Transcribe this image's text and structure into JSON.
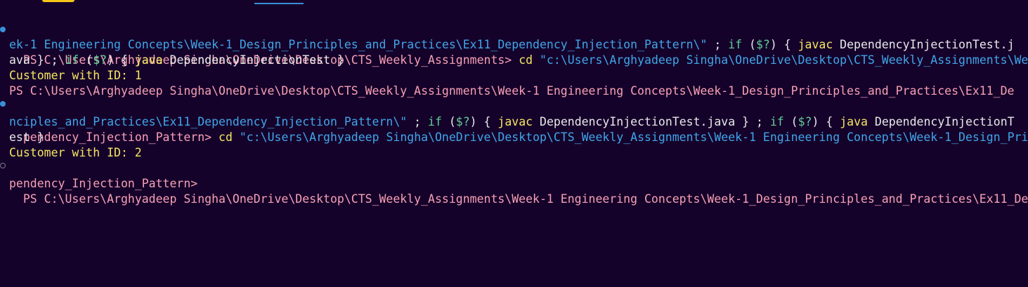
{
  "terminal": {
    "lines": [
      [
        {
          "c": "c-prompt",
          "t": "PS C:\\Users\\Arghyadeep Singha\\OneDrive\\Desktop\\CTS_Weekly_Assignments> "
        },
        {
          "c": "c-cmd",
          "t": "cd "
        },
        {
          "c": "c-str",
          "t": "\"c:\\Users\\Arghyadeep Singha\\OneDrive\\Desktop\\CTS_Weekly_Assignments\\We"
        }
      ],
      [
        {
          "c": "c-str",
          "t": "ek-1 Engineering Concepts\\Week-1_Design_Principles_and_Practices\\Ex11_Dependency_Injection_Pattern\\\""
        },
        {
          "c": "c-plain",
          "t": " ; "
        },
        {
          "c": "c-kw",
          "t": "if "
        },
        {
          "c": "c-plain",
          "t": "("
        },
        {
          "c": "c-kw",
          "t": "$?"
        },
        {
          "c": "c-plain",
          "t": ") { "
        },
        {
          "c": "c-cmd",
          "t": "javac"
        },
        {
          "c": "c-plain",
          "t": " DependencyInjectionTest.j"
        }
      ],
      [
        {
          "c": "c-plain",
          "t": "ava } ; "
        },
        {
          "c": "c-kw",
          "t": "if "
        },
        {
          "c": "c-plain",
          "t": "("
        },
        {
          "c": "c-kw",
          "t": "$?"
        },
        {
          "c": "c-plain",
          "t": ") { "
        },
        {
          "c": "c-cmd",
          "t": "java"
        },
        {
          "c": "c-plain",
          "t": " DependencyInjectionTest }"
        }
      ],
      [
        {
          "c": "c-cmd",
          "t": "Customer with ID: 1"
        }
      ],
      [
        {
          "c": "c-prompt",
          "t": "PS C:\\Users\\Arghyadeep Singha\\OneDrive\\Desktop\\CTS_Weekly_Assignments\\Week-1 Engineering Concepts\\Week-1_Design_Principles_and_Practices\\Ex11_De"
        }
      ],
      [
        {
          "c": "c-prompt",
          "t": "pendency_Injection_Pattern> "
        },
        {
          "c": "c-cmd",
          "t": "cd "
        },
        {
          "c": "c-str",
          "t": "\"c:\\Users\\Arghyadeep Singha\\OneDrive\\Desktop\\CTS_Weekly_Assignments\\Week-1 Engineering Concepts\\Week-1_Design_Pri"
        }
      ],
      [
        {
          "c": "c-str",
          "t": "nciples_and_Practices\\Ex11_Dependency_Injection_Pattern\\\""
        },
        {
          "c": "c-plain",
          "t": " ; "
        },
        {
          "c": "c-kw",
          "t": "if "
        },
        {
          "c": "c-plain",
          "t": "("
        },
        {
          "c": "c-kw",
          "t": "$?"
        },
        {
          "c": "c-plain",
          "t": ") { "
        },
        {
          "c": "c-cmd",
          "t": "javac"
        },
        {
          "c": "c-plain",
          "t": " DependencyInjectionTest.java } ; "
        },
        {
          "c": "c-kw",
          "t": "if "
        },
        {
          "c": "c-plain",
          "t": "("
        },
        {
          "c": "c-kw",
          "t": "$?"
        },
        {
          "c": "c-plain",
          "t": ") { "
        },
        {
          "c": "c-cmd",
          "t": "java"
        },
        {
          "c": "c-plain",
          "t": " DependencyInjectionT"
        }
      ],
      [
        {
          "c": "c-plain",
          "t": "est }"
        }
      ],
      [
        {
          "c": "c-cmd",
          "t": "Customer with ID: 2"
        }
      ],
      [
        {
          "c": "c-prompt",
          "t": "PS C:\\Users\\Arghyadeep Singha\\OneDrive\\Desktop\\CTS_Weekly_Assignments\\Week-1 Engineering Concepts\\Week-1_Design_Principles_and_Practices\\Ex11_De"
        }
      ],
      [
        {
          "c": "c-prompt",
          "t": "pendency_Injection_Pattern>"
        }
      ]
    ],
    "markers": [
      "ok",
      "ok",
      "pending"
    ],
    "colors": {
      "background": "#15022b",
      "prompt": "#f7a0b4",
      "command": "#f5e663",
      "string": "#40a6e8",
      "keyword": "#5fcf96",
      "text": "#e9e9e9",
      "success_marker": "#3b8fd8"
    }
  }
}
